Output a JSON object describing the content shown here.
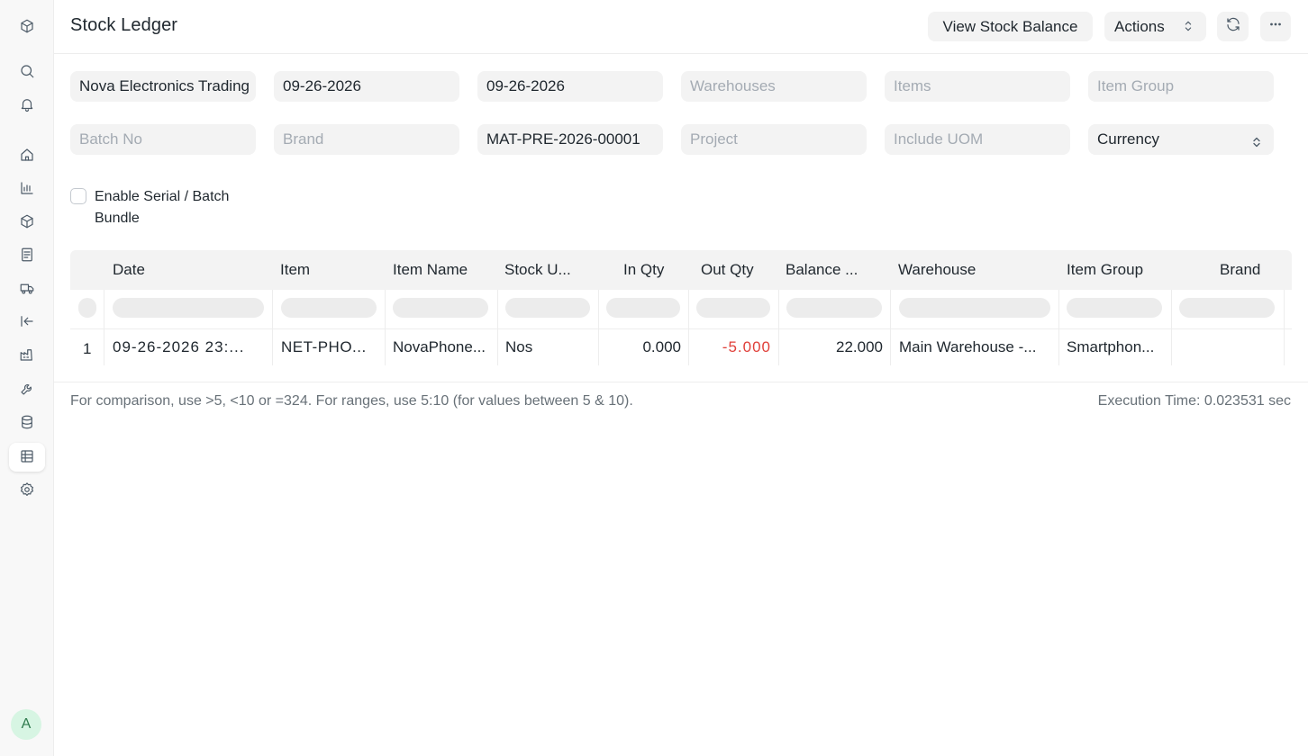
{
  "sidebar": {
    "items": [
      {
        "icon": "cube-logo-icon"
      },
      {
        "icon": "search-icon"
      },
      {
        "icon": "bell-icon"
      },
      {
        "icon": "home-icon"
      },
      {
        "icon": "bar-chart-icon"
      },
      {
        "icon": "box-icon"
      },
      {
        "icon": "document-icon"
      },
      {
        "icon": "truck-icon"
      },
      {
        "icon": "arrow-left-bar-icon"
      },
      {
        "icon": "factory-icon"
      },
      {
        "icon": "wrench-icon"
      },
      {
        "icon": "database-icon"
      },
      {
        "icon": "table-icon"
      },
      {
        "icon": "gear-icon"
      }
    ],
    "active": "table-icon",
    "avatar": "A"
  },
  "header": {
    "title": "Stock Ledger",
    "view_stock_balance": "View Stock Balance",
    "actions": "Actions"
  },
  "filters": {
    "company": "Nova Electronics Trading",
    "from_date": "09-26-2026",
    "to_date": "09-26-2026",
    "warehouses_placeholder": "Warehouses",
    "items_placeholder": "Items",
    "item_group_placeholder": "Item Group",
    "batch_no_placeholder": "Batch No",
    "brand_placeholder": "Brand",
    "voucher_no": "MAT-PRE-2026-00001",
    "project_placeholder": "Project",
    "include_uom_placeholder": "Include UOM",
    "currency": "Currency",
    "serial_batch_label": "Enable Serial / Batch Bundle"
  },
  "table": {
    "columns": [
      "Date",
      "Item",
      "Item Name",
      "Stock U...",
      "In Qty",
      "Out Qty",
      "Balance ...",
      "Warehouse",
      "Item Group",
      "Brand"
    ],
    "rows": [
      {
        "index": "1",
        "date": "09-26-2026 23:...",
        "item": "NET-PHO...",
        "item_name": "NovaPhone...",
        "uom": "Nos",
        "in_qty": "0.000",
        "out_qty": "-5.000",
        "balance": "22.000",
        "warehouse": "Main Warehouse -...",
        "item_group": "Smartphon...",
        "brand": ""
      }
    ]
  },
  "footer": {
    "hint": "For comparison, use >5, <10 or =324. For ranges, use 5:10 (for values between 5 & 10).",
    "execution_time": "Execution Time: 0.023531 sec"
  },
  "colors": {
    "negative": "#e0403a",
    "field_bg": "#f3f3f3",
    "avatar_bg": "#d7f5e3"
  }
}
